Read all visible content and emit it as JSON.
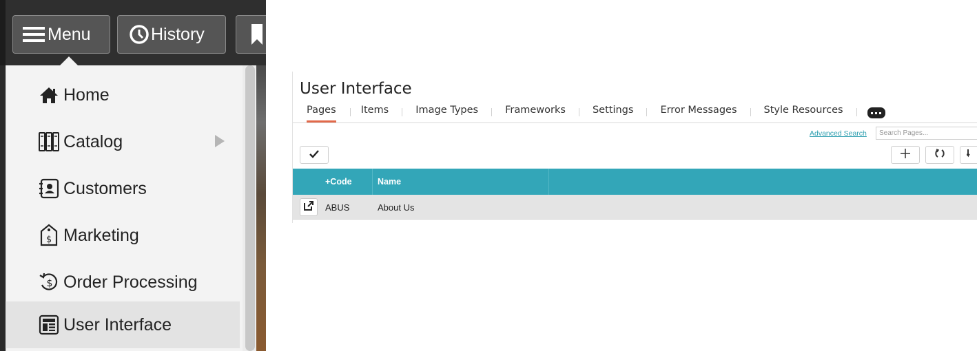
{
  "topbar": {
    "menu_label": "Menu",
    "history_label": "History",
    "menu_icon": "hamburger-icon",
    "history_icon": "clock-icon",
    "bookmark_icon": "bookmark-icon"
  },
  "menu": {
    "items": [
      {
        "label": "Home",
        "icon": "home-icon"
      },
      {
        "label": "Catalog",
        "icon": "catalog-icon",
        "has_submenu": true
      },
      {
        "label": "Customers",
        "icon": "address-book-icon"
      },
      {
        "label": "Marketing",
        "icon": "price-tag-icon"
      },
      {
        "label": "Order Processing",
        "icon": "dollar-cycle-icon"
      },
      {
        "label": "User Interface",
        "icon": "layout-icon",
        "active": true
      }
    ]
  },
  "main": {
    "title": "User Interface",
    "tabs": [
      {
        "label": "Pages",
        "active": true
      },
      {
        "label": "Items"
      },
      {
        "label": "Image Types"
      },
      {
        "label": "Frameworks"
      },
      {
        "label": "Settings"
      },
      {
        "label": "Error Messages"
      },
      {
        "label": "Style Resources"
      }
    ],
    "advanced_search": "Advanced Search",
    "search_placeholder": "Search Pages...",
    "grid": {
      "columns": [
        "+Code",
        "Name"
      ],
      "rows": [
        {
          "code": "ABUS",
          "name": "About Us"
        }
      ]
    },
    "accent_color": "#33a6b8",
    "active_tab_color": "#e2694a"
  }
}
